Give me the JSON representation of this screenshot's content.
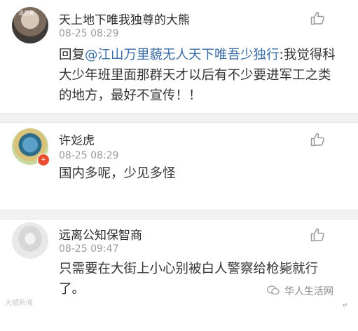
{
  "comments": [
    {
      "username": "天上地下唯我独尊的大熊",
      "time": "08-25 08:29",
      "avatar_label": "法克斯",
      "reply_prefix": "回复",
      "reply_target": "@江山万里藐无人天下唯吾少独行",
      "content": ":我觉得科大少年班里面那群天才以后有不少要进军工之类的地方，最好不宣传！！"
    },
    {
      "username": "许彣虎",
      "time": "08-25 08:29",
      "badge": "+",
      "content": "国内多呢，少见多怪"
    },
    {
      "username": "远离公知保智商",
      "time": "08-25 09:47",
      "content": "只需要在大街上小心别被白人警察给枪毙就行了。"
    }
  ],
  "watermark": {
    "left_text": "大城新闻",
    "right_text": "华人生活网"
  },
  "colors": {
    "link": "#3a6ea5",
    "meta": "#9a9a9a",
    "divider": "#f2f2f2"
  },
  "icons": {
    "like": "thumbs-up-icon"
  }
}
